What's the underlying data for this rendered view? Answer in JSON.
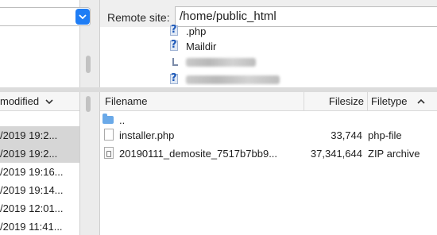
{
  "remote": {
    "label": "Remote site:",
    "path": "/home/public_html",
    "tree": [
      {
        "name": ".php",
        "icon": "question-file-icon"
      },
      {
        "name": "Maildir",
        "icon": "question-file-icon"
      },
      {
        "name": "",
        "icon": "folder-arrow-icon"
      },
      {
        "name": "",
        "icon": "question-file-icon"
      }
    ],
    "columns": {
      "filename": "Filename",
      "filesize": "Filesize",
      "filetype": "Filetype"
    },
    "files": [
      {
        "name": "..",
        "size": "",
        "type": "",
        "icon": "folder-icon"
      },
      {
        "name": "installer.php",
        "size": "33,744",
        "type": "php-file",
        "icon": "file-icon"
      },
      {
        "name": "20190111_demosite_7517b7bb9...",
        "size": "37,341,644",
        "type": "ZIP archive",
        "icon": "zip-icon"
      }
    ]
  },
  "local": {
    "column": "modified",
    "rows": [
      {
        "date": "/2019 19:2...",
        "selected": true
      },
      {
        "date": "/2019 19:2...",
        "selected": true
      },
      {
        "date": "/2019 19:16...",
        "selected": false
      },
      {
        "date": "/2019 19:14...",
        "selected": false
      },
      {
        "date": "/2019 12:01...",
        "selected": false
      },
      {
        "date": "/2019 11:41...",
        "selected": false
      }
    ]
  },
  "colors": {
    "accent": "#1f7df5",
    "selection": "#d6d6d6"
  }
}
